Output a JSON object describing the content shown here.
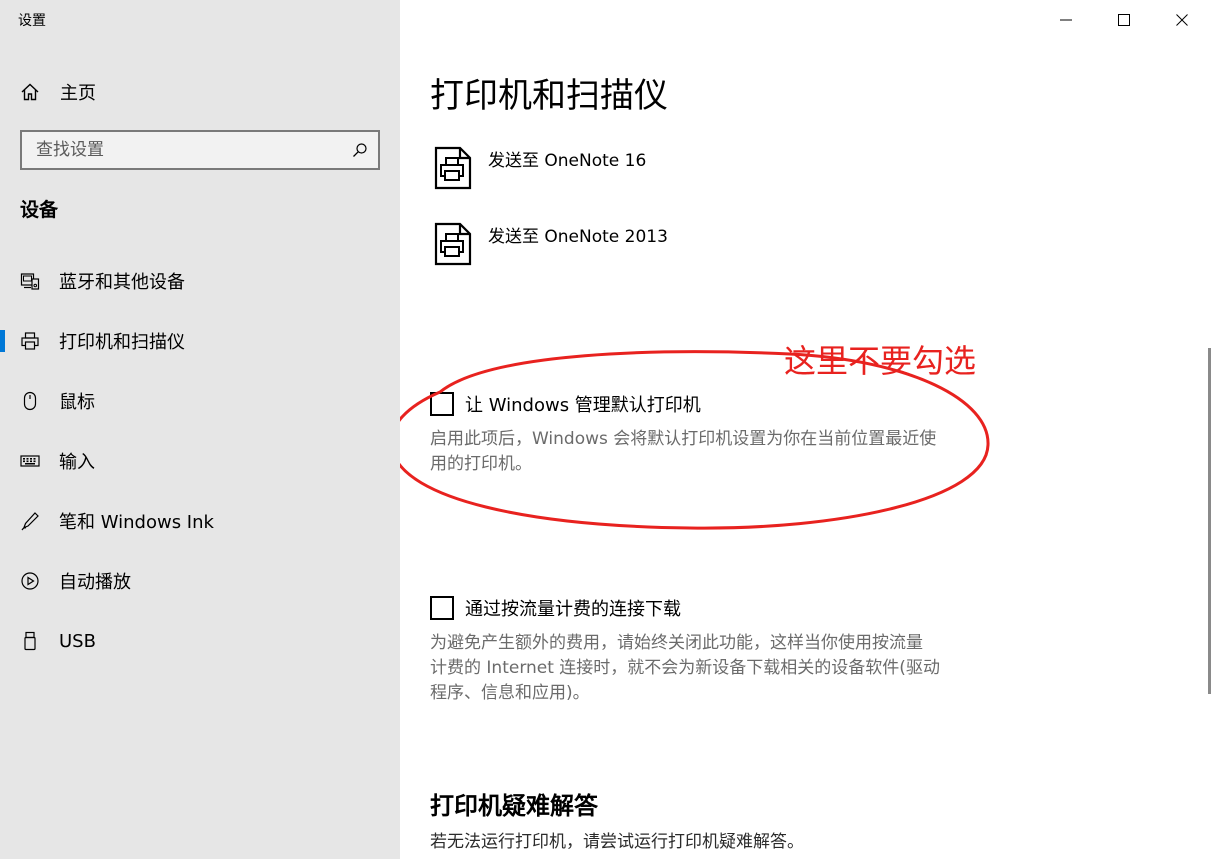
{
  "window": {
    "title": "设置"
  },
  "sidebar": {
    "home_label": "主页",
    "search_placeholder": "查找设置",
    "section_heading": "设备",
    "items": [
      {
        "label": "蓝牙和其他设备",
        "icon": "bluetooth-devices-icon",
        "active": false
      },
      {
        "label": "打印机和扫描仪",
        "icon": "printer-icon",
        "active": true
      },
      {
        "label": "鼠标",
        "icon": "mouse-icon",
        "active": false
      },
      {
        "label": "输入",
        "icon": "keyboard-icon",
        "active": false
      },
      {
        "label": "笔和 Windows Ink",
        "icon": "pen-icon",
        "active": false
      },
      {
        "label": "自动播放",
        "icon": "autoplay-icon",
        "active": false
      },
      {
        "label": "USB",
        "icon": "usb-icon",
        "active": false
      }
    ]
  },
  "main": {
    "title": "打印机和扫描仪",
    "printers": [
      {
        "name": "发送至 OneNote 16"
      },
      {
        "name": "发送至 OneNote 2013"
      }
    ],
    "default_printer": {
      "label": "让 Windows 管理默认打印机",
      "checked": false,
      "desc_line1": "启用此项后，Windows 会将默认打印机设置为你在当前位置最近使",
      "desc_line2": "用的打印机。"
    },
    "metered": {
      "label": "通过按流量计费的连接下载",
      "checked": false,
      "desc_line1": "为避免产生额外的费用，请始终关闭此功能，这样当你使用按流量",
      "desc_line2": "计费的 Internet 连接时，就不会为新设备下载相关的设备软件(驱动",
      "desc_line3": "程序、信息和应用)。"
    },
    "troubleshoot": {
      "heading": "打印机疑难解答",
      "desc": "若无法运行打印机，请尝试运行打印机疑难解答。"
    }
  },
  "annotation": {
    "text": "这里不要勾选",
    "color": "#e8221f"
  },
  "colors": {
    "sidebar_bg": "#e6e6e6",
    "accent": "#0078d7",
    "desc_text": "#6b6b6b"
  }
}
